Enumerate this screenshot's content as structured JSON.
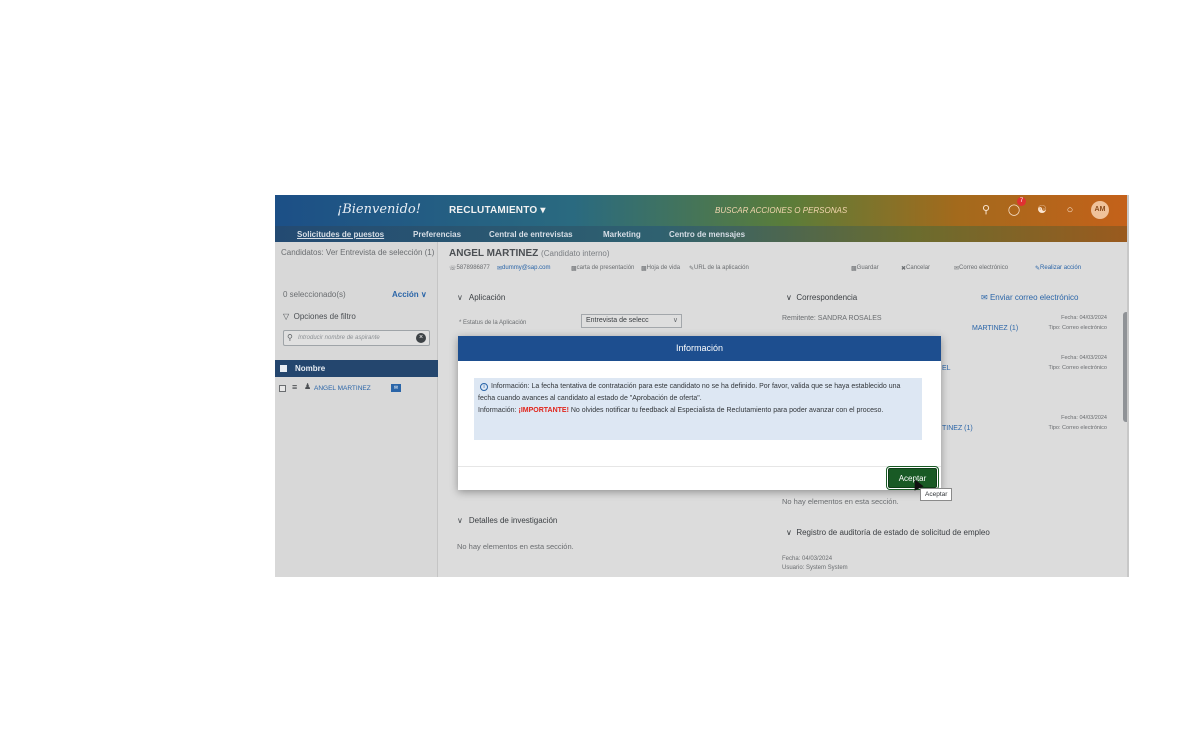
{
  "header": {
    "brand": "¡Bienvenido!",
    "module": "RECLUTAMIENTO ▾",
    "search_placeholder": "BUSCAR ACCIONES O PERSONAS",
    "notifications_count": "7",
    "avatar_initials": "AM"
  },
  "nav": {
    "tabs": [
      {
        "label": "Solicitudes de puestos"
      },
      {
        "label": "Preferencias"
      },
      {
        "label": "Central de entrevistas"
      },
      {
        "label": "Marketing"
      },
      {
        "label": "Centro de mensajes"
      }
    ]
  },
  "left": {
    "title": "Candidatos: Ver Entrevista de selección (1)",
    "selected": "0 seleccionado(s)",
    "action": "Acción ∨",
    "filter": "Opciones de filtro",
    "search_placeholder": "Introducir nombre de aspirante",
    "column": "Nombre",
    "row_name": "ANGEL MARTINEZ"
  },
  "candidate": {
    "name": "ANGEL MARTINEZ",
    "type": "(Candidato interno)",
    "phone": "5878986877",
    "email": "dummy@sap.com",
    "links": [
      "carta de presentación",
      "Hoja de vida",
      "URL de la aplicación"
    ],
    "actions": [
      "Guardar",
      "Cancelar",
      "Correo electrónico",
      "Realizar acción"
    ]
  },
  "application": {
    "section": "Aplicación",
    "status_label": "* Estatus de la Aplicación",
    "status_value": "Entrevista de selecc"
  },
  "investigation": {
    "section": "Detalles de investigación",
    "empty": "No hay elementos en esta sección."
  },
  "correspondence": {
    "section": "Correspondencia",
    "send": "Enviar correo electrónico",
    "items": [
      {
        "from": "Remitente: SANDRA ROSALES",
        "date": "Fecha: 04/03/2024",
        "to": "MARTINEZ (1)",
        "tipo": "Tipo: Correo electrónico"
      },
      {
        "from": "",
        "date": "Fecha: 04/03/2024",
        "to": "EL",
        "tipo": "Tipo: Correo electrónico"
      },
      {
        "from": "",
        "date": "Fecha: 04/03/2024",
        "to": "TINEZ (1)",
        "tipo": "Tipo: Correo electrónico"
      }
    ],
    "empty": "No hay elementos en esta sección."
  },
  "audit": {
    "section": "Registro de auditoría de estado de solicitud de empleo",
    "date": "Fecha: 04/03/2024",
    "user": "Usuario: System System"
  },
  "dialog": {
    "title": "Información",
    "line1": "Información: La fecha tentativa de contratación para este candidato no se ha definido. Por favor, valida que se haya establecido una fecha cuando avances al candidato al estado de \"Aprobación de oferta\".",
    "line2_prefix": "Información:",
    "line2_important": "¡IMPORTANTE!",
    "line2_rest": "No olvides notificar tu feedback al Especialista de Reclutamiento para poder avanzar con el proceso.",
    "ok": "Aceptar",
    "tooltip": "Aceptar"
  }
}
